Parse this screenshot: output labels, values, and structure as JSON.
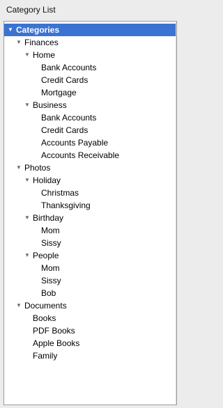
{
  "header": {
    "title": "Category List"
  },
  "tree": {
    "nodes": [
      {
        "label": "Categories",
        "level": 0,
        "expandable": true,
        "selected": true
      },
      {
        "label": "Finances",
        "level": 1,
        "expandable": true,
        "selected": false
      },
      {
        "label": "Home",
        "level": 2,
        "expandable": true,
        "selected": false
      },
      {
        "label": "Bank Accounts",
        "level": 3,
        "expandable": false,
        "selected": false
      },
      {
        "label": "Credit Cards",
        "level": 3,
        "expandable": false,
        "selected": false
      },
      {
        "label": "Mortgage",
        "level": 3,
        "expandable": false,
        "selected": false
      },
      {
        "label": "Business",
        "level": 2,
        "expandable": true,
        "selected": false
      },
      {
        "label": "Bank Accounts",
        "level": 3,
        "expandable": false,
        "selected": false
      },
      {
        "label": "Credit Cards",
        "level": 3,
        "expandable": false,
        "selected": false
      },
      {
        "label": "Accounts Payable",
        "level": 3,
        "expandable": false,
        "selected": false
      },
      {
        "label": "Accounts Receivable",
        "level": 3,
        "expandable": false,
        "selected": false
      },
      {
        "label": "Photos",
        "level": 1,
        "expandable": true,
        "selected": false
      },
      {
        "label": "Holiday",
        "level": 2,
        "expandable": true,
        "selected": false
      },
      {
        "label": "Christmas",
        "level": 3,
        "expandable": false,
        "selected": false
      },
      {
        "label": "Thanksgiving",
        "level": 3,
        "expandable": false,
        "selected": false
      },
      {
        "label": "Birthday",
        "level": 2,
        "expandable": true,
        "selected": false
      },
      {
        "label": "Mom",
        "level": 3,
        "expandable": false,
        "selected": false
      },
      {
        "label": "Sissy",
        "level": 3,
        "expandable": false,
        "selected": false
      },
      {
        "label": "People",
        "level": 2,
        "expandable": true,
        "selected": false
      },
      {
        "label": "Mom",
        "level": 3,
        "expandable": false,
        "selected": false
      },
      {
        "label": "Sissy",
        "level": 3,
        "expandable": false,
        "selected": false
      },
      {
        "label": "Bob",
        "level": 3,
        "expandable": false,
        "selected": false
      },
      {
        "label": "Documents",
        "level": 1,
        "expandable": true,
        "selected": false
      },
      {
        "label": "Books",
        "level": 2,
        "expandable": false,
        "selected": false
      },
      {
        "label": "PDF Books",
        "level": 2,
        "expandable": false,
        "selected": false
      },
      {
        "label": "Apple Books",
        "level": 2,
        "expandable": false,
        "selected": false
      },
      {
        "label": "Family",
        "level": 2,
        "expandable": false,
        "selected": false
      }
    ]
  },
  "colors": {
    "selection": "#3b73d3",
    "background": "#ececec",
    "panel": "#ffffff",
    "disclosure": "#6b6b6b"
  },
  "icons": {
    "expanded": "disclosure-triangle-down-icon"
  }
}
